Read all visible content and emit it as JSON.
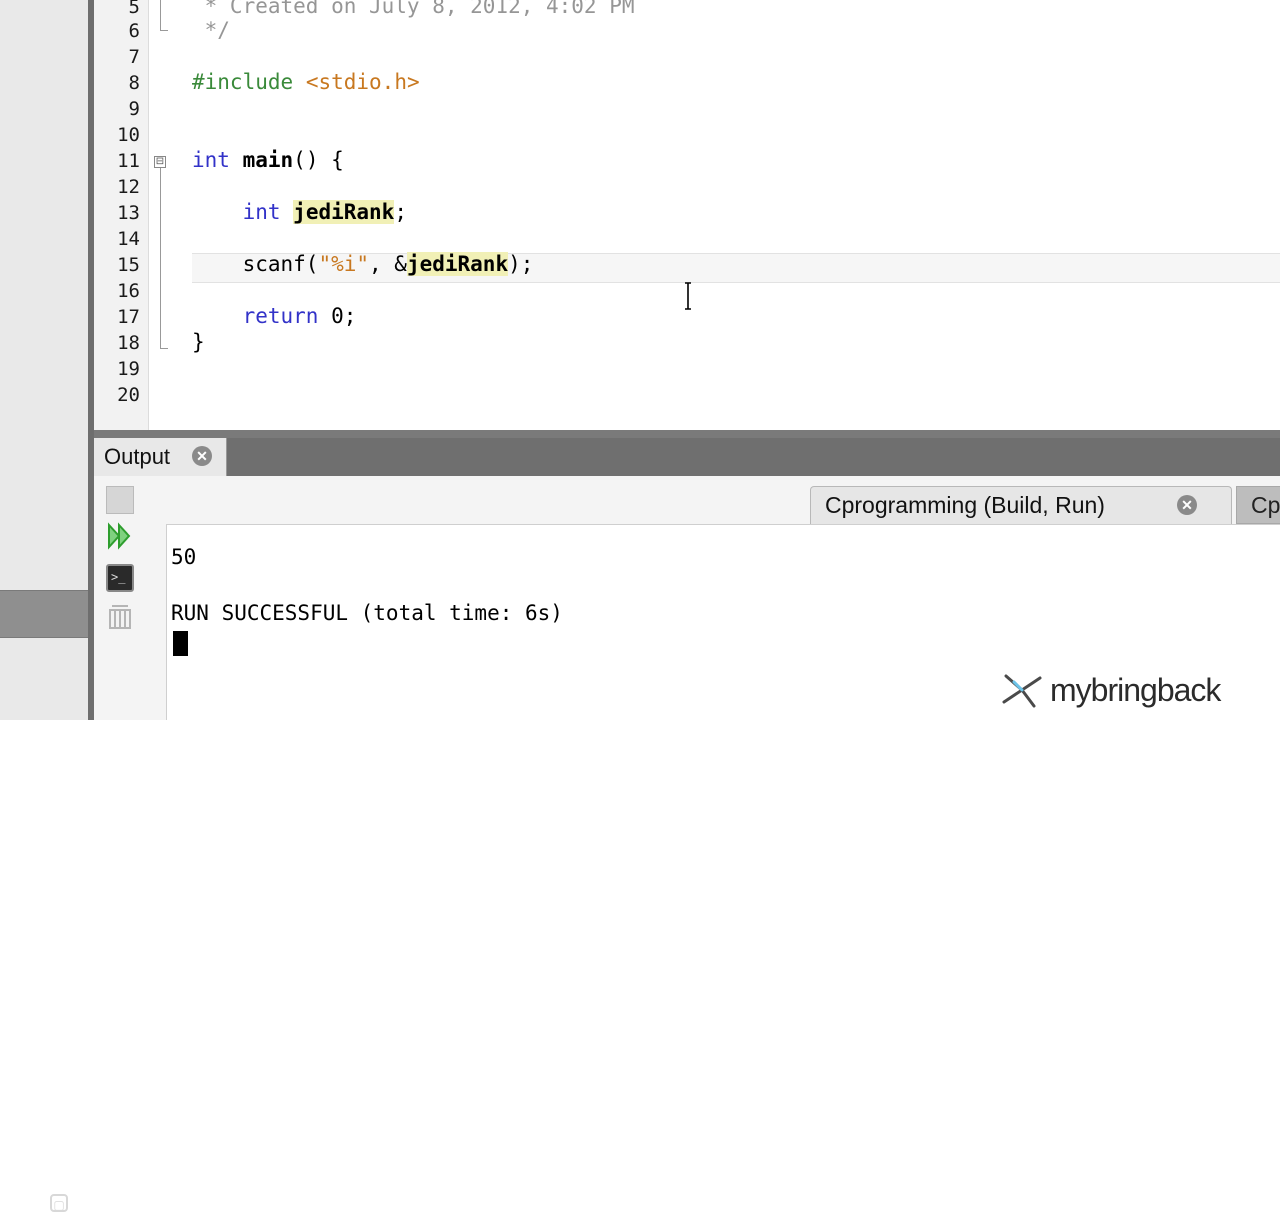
{
  "editor": {
    "lines": [
      {
        "no": "5",
        "text": " * Created on July 8, 2012, 4:02 PM"
      },
      {
        "no": "6",
        "text": " */"
      },
      {
        "no": "7",
        "text": ""
      },
      {
        "no": "8",
        "text": "#include <stdio.h>"
      },
      {
        "no": "9",
        "text": ""
      },
      {
        "no": "10",
        "text": ""
      },
      {
        "no": "11",
        "text": "int main() {"
      },
      {
        "no": "12",
        "text": ""
      },
      {
        "no": "13",
        "text": "    int jediRank;"
      },
      {
        "no": "14",
        "text": ""
      },
      {
        "no": "15",
        "text": "    scanf(\"%i\", &jediRank);"
      },
      {
        "no": "16",
        "text": ""
      },
      {
        "no": "17",
        "text": "    return 0;"
      },
      {
        "no": "18",
        "text": "}"
      },
      {
        "no": "19",
        "text": ""
      },
      {
        "no": "20",
        "text": ""
      }
    ],
    "tokens": {
      "comment_line5": " * Created on July 8, 2012, 4:02 PM",
      "comment_line6": " */",
      "include_directive": "#include",
      "include_target": "<stdio.h>",
      "kw_int": "int",
      "fn_main": "main",
      "main_rest": "() {",
      "var_jedirank": "jediRank",
      "semicolon": ";",
      "scanf_call": "scanf(",
      "format_string": "\"%i\"",
      "scanf_amp": ", &",
      "scanf_end": ");",
      "kw_return": "return",
      "return_value": " 0;",
      "close_brace": "}"
    },
    "fold_marker": "⊟"
  },
  "output_panel": {
    "tab_label": "Output",
    "close_glyph": "✕",
    "subtab_label": "Cprogramming (Build, Run)",
    "subtab2_label": "Cp",
    "console_lines": [
      "50",
      "",
      "RUN SUCCESSFUL (total time: 6s)"
    ]
  },
  "toolbar_icons": [
    "stop-icon",
    "rerun-icon",
    "terminal-icon",
    "settings-icon"
  ],
  "watermark": {
    "text": "mybringback"
  },
  "colors": {
    "keyword": "#3232c8",
    "preprocessor": "#3a8a3a",
    "string": "#c87820",
    "comment": "#969696",
    "highlight": "#f1f0b6",
    "run_green": "#2e9e2e"
  }
}
